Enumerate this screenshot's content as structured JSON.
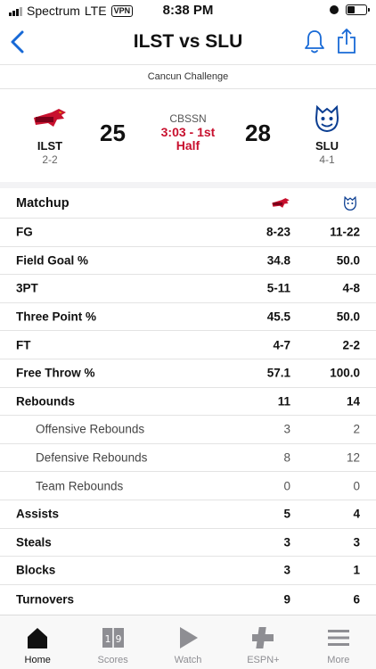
{
  "status_bar": {
    "carrier": "Spectrum",
    "network": "LTE",
    "vpn": "VPN",
    "time": "8:38 PM"
  },
  "nav": {
    "title": "ILST vs SLU",
    "back_icon": "chevron-left-icon",
    "alert_icon": "bell-icon",
    "share_icon": "share-icon"
  },
  "event": "Cancun Challenge",
  "game": {
    "away": {
      "abbr": "ILST",
      "record": "2-2",
      "score": "25",
      "color": "#c8102e"
    },
    "home": {
      "abbr": "SLU",
      "record": "4-1",
      "score": "28",
      "color": "#0a3d91"
    },
    "network": "CBSSN",
    "clock": "3:03 - 1st",
    "period": "Half"
  },
  "matchup": {
    "header": "Matchup",
    "rows": [
      {
        "label": "FG",
        "away": "8-23",
        "home": "11-22",
        "sub": false
      },
      {
        "label": "Field Goal %",
        "away": "34.8",
        "home": "50.0",
        "sub": false
      },
      {
        "label": "3PT",
        "away": "5-11",
        "home": "4-8",
        "sub": false
      },
      {
        "label": "Three Point %",
        "away": "45.5",
        "home": "50.0",
        "sub": false
      },
      {
        "label": "FT",
        "away": "4-7",
        "home": "2-2",
        "sub": false
      },
      {
        "label": "Free Throw %",
        "away": "57.1",
        "home": "100.0",
        "sub": false
      },
      {
        "label": "Rebounds",
        "away": "11",
        "home": "14",
        "sub": false
      },
      {
        "label": "Offensive Rebounds",
        "away": "3",
        "home": "2",
        "sub": true
      },
      {
        "label": "Defensive Rebounds",
        "away": "8",
        "home": "12",
        "sub": true
      },
      {
        "label": "Team Rebounds",
        "away": "0",
        "home": "0",
        "sub": true
      },
      {
        "label": "Assists",
        "away": "5",
        "home": "4",
        "sub": false
      },
      {
        "label": "Steals",
        "away": "3",
        "home": "3",
        "sub": false
      },
      {
        "label": "Blocks",
        "away": "3",
        "home": "1",
        "sub": false
      },
      {
        "label": "Turnovers",
        "away": "9",
        "home": "6",
        "sub": false
      }
    ]
  },
  "tabbar": {
    "tabs": [
      {
        "label": "Home",
        "icon": "home-icon",
        "active": true
      },
      {
        "label": "Scores",
        "icon": "scores-icon",
        "active": false
      },
      {
        "label": "Watch",
        "icon": "play-icon",
        "active": false
      },
      {
        "label": "ESPN+",
        "icon": "plus-icon",
        "active": false
      },
      {
        "label": "More",
        "icon": "menu-icon",
        "active": false
      }
    ]
  }
}
